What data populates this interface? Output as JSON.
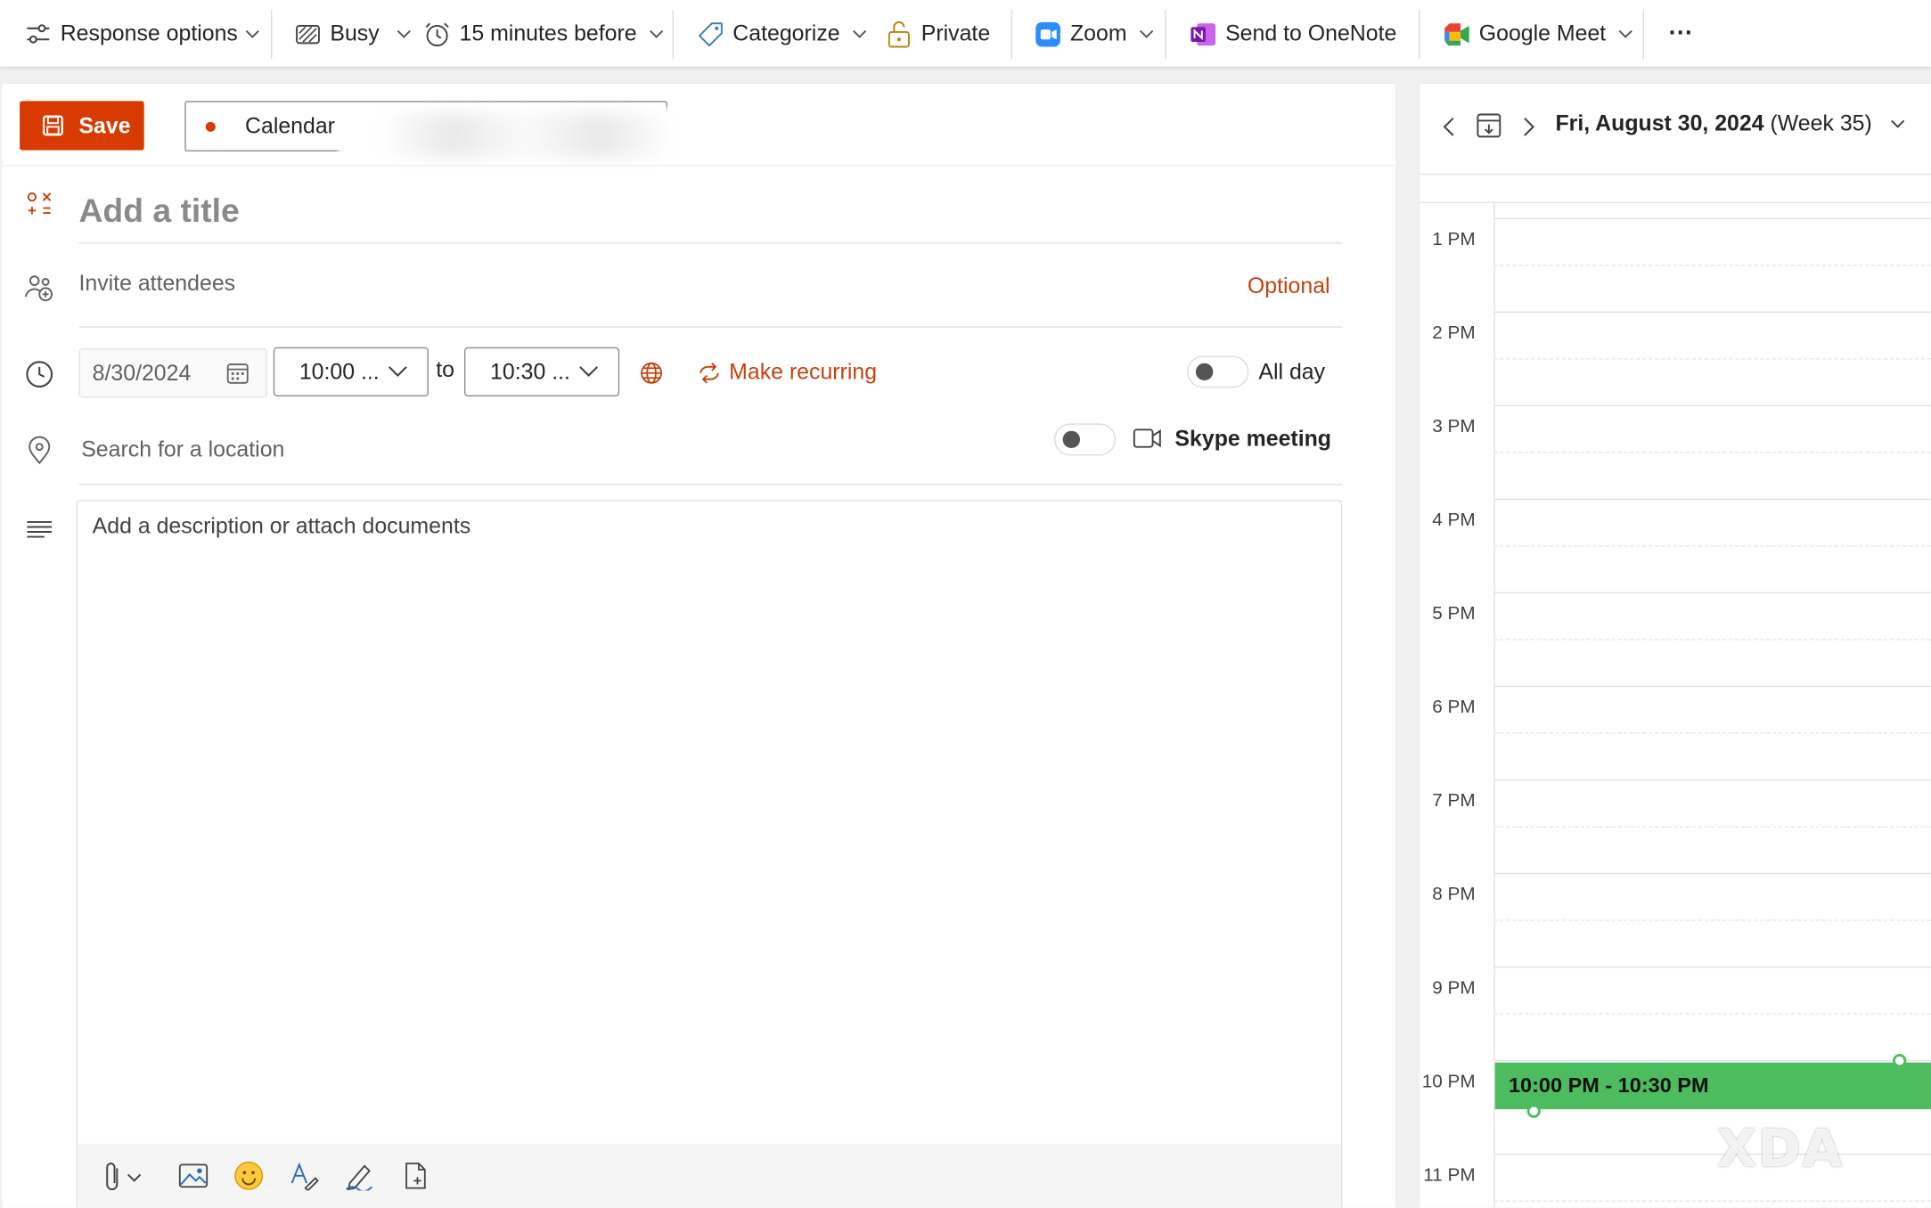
{
  "toolbar": {
    "response_options": "Response options",
    "busy": "Busy",
    "reminder": "15 minutes before",
    "categorize": "Categorize",
    "private": "Private",
    "zoom": "Zoom",
    "onenote": "Send to OneNote",
    "google_meet": "Google Meet",
    "more": "···"
  },
  "form": {
    "save_label": "Save",
    "calendar_label": "Calendar",
    "title_placeholder": "Add a title",
    "attendees_placeholder": "Invite attendees",
    "optional_label": "Optional",
    "date": "8/30/2024",
    "start_time": "10:00 ...",
    "to_label": "to",
    "end_time": "10:30 ...",
    "make_recurring": "Make recurring",
    "all_day_label": "All day",
    "location_placeholder": "Search for a location",
    "skype_label": "Skype meeting",
    "description_placeholder": "Add a description or attach documents"
  },
  "day_view": {
    "date_bold": "Fri, August 30, 2024",
    "week": " (Week 35)",
    "hours": [
      "1 PM",
      "2 PM",
      "3 PM",
      "4 PM",
      "5 PM",
      "6 PM",
      "7 PM",
      "8 PM",
      "9 PM",
      "10 PM",
      "11 PM"
    ],
    "event_label": "10:00 PM - 10:30 PM"
  },
  "watermark": "XDA",
  "colors": {
    "accent": "#d83b01",
    "link": "#c4420f",
    "event": "#4cbc5f"
  }
}
